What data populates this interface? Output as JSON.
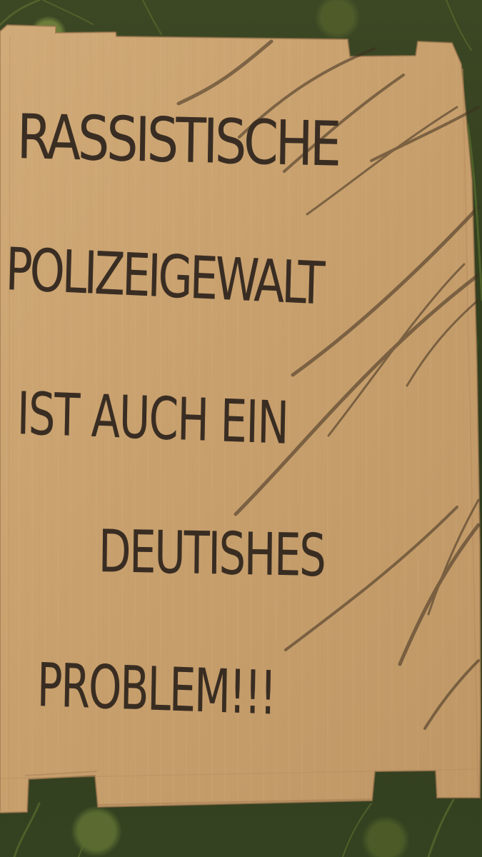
{
  "image": {
    "description": "",
    "sign": {
      "lines": [
        "RASSISTISCHE",
        "POLIZEIGEWALT",
        "IST AUCH EIN",
        "DEUTISHES",
        "PROBLEM!!!"
      ]
    },
    "colors": {
      "cardboard": "#c7a06e",
      "ink": "#2a211b",
      "grass": "#394622"
    }
  }
}
